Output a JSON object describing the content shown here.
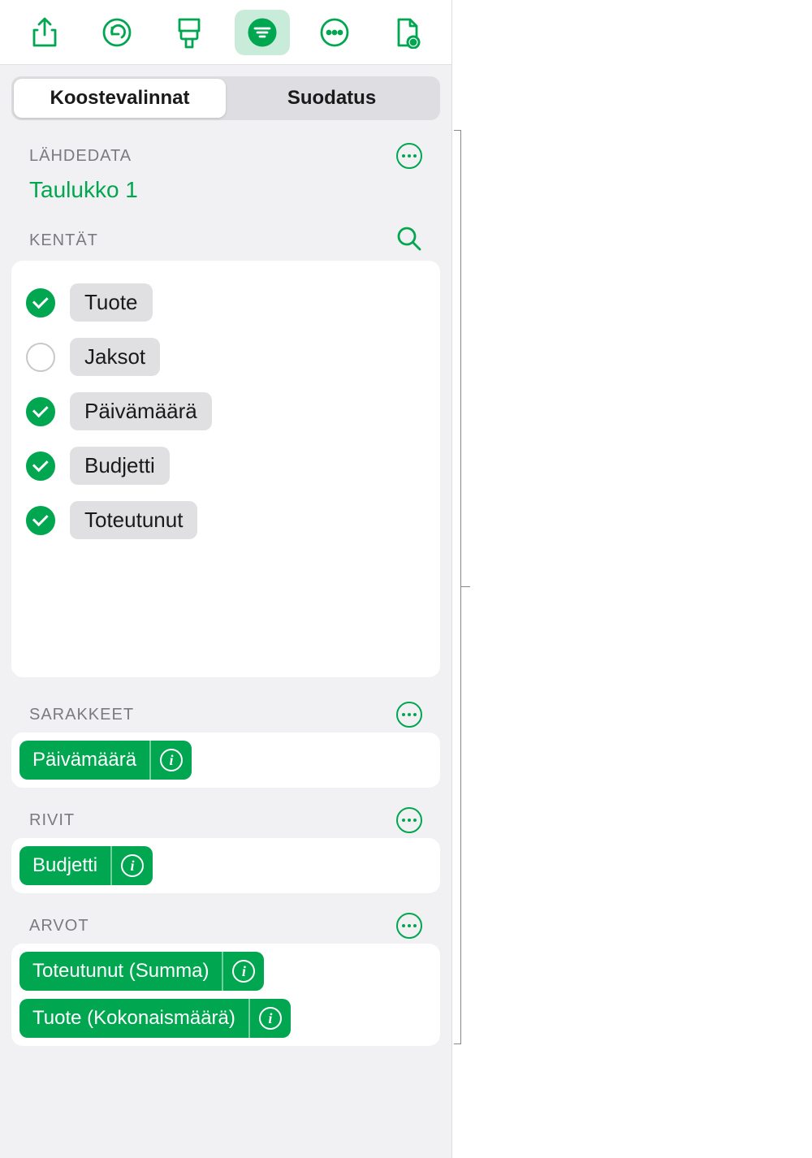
{
  "toolbar": {
    "icons": [
      "share-icon",
      "undo-icon",
      "brush-icon",
      "organize-icon",
      "more-icon",
      "document-view-icon"
    ],
    "active_index": 3
  },
  "tabs": {
    "pivot": "Koostevalinnat",
    "filter": "Suodatus",
    "active": "pivot"
  },
  "source": {
    "label": "LÄHDEDATA",
    "name": "Taulukko 1"
  },
  "fields": {
    "label": "KENTÄT",
    "items": [
      {
        "name": "Tuote",
        "checked": true
      },
      {
        "name": "Jaksot",
        "checked": false
      },
      {
        "name": "Päivämäärä",
        "checked": true
      },
      {
        "name": "Budjetti",
        "checked": true
      },
      {
        "name": "Toteutunut",
        "checked": true
      }
    ]
  },
  "columns": {
    "label": "SARAKKEET",
    "items": [
      "Päivämäärä"
    ]
  },
  "rows": {
    "label": "RIVIT",
    "items": [
      "Budjetti"
    ]
  },
  "values": {
    "label": "ARVOT",
    "items": [
      "Toteutunut (Summa)",
      "Tuote (Kokonaismäärä)"
    ]
  }
}
